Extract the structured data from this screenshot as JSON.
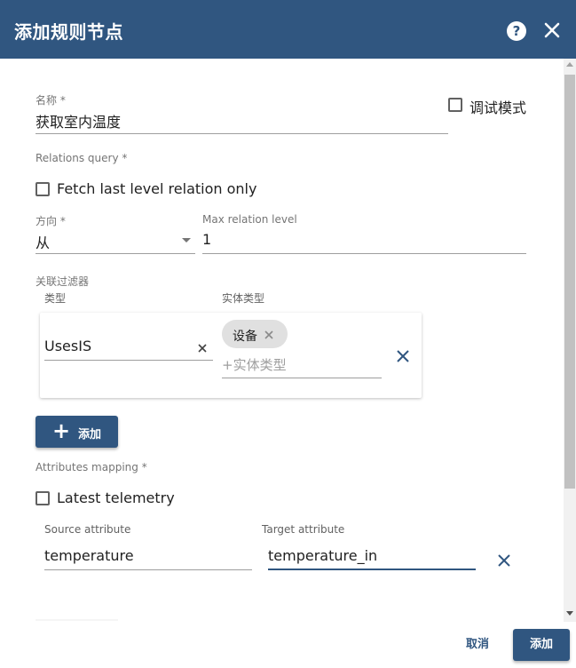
{
  "header": {
    "title": "添加规则节点",
    "help_icon": "question-circle-icon",
    "help_glyph": "?",
    "close_icon": "close-icon"
  },
  "name_field": {
    "label": "名称 *",
    "value": "获取室内温度"
  },
  "debug_mode": {
    "label": "调试模式",
    "checked": false
  },
  "relations_query": {
    "label": "Relations query *",
    "fetch_last_level": {
      "label": "Fetch last level relation only",
      "checked": false
    },
    "direction": {
      "label": "方向 *",
      "value": "从"
    },
    "max_relation_level": {
      "label": "Max relation level",
      "value": "1"
    }
  },
  "relation_filters": {
    "label": "关联过滤器",
    "column_type": "类型",
    "column_entity_types": "实体类型",
    "rows": [
      {
        "type_value": "UsesIS",
        "entity_type_chips": [
          "设备"
        ],
        "entity_type_placeholder": "+实体类型"
      }
    ],
    "add_button": {
      "icon": "plus-icon",
      "glyph": "+",
      "label": "添加"
    }
  },
  "attributes_mapping": {
    "label": "Attributes mapping *",
    "latest_telemetry": {
      "label": "Latest telemetry",
      "checked": false
    },
    "column_source": "Source attribute",
    "column_target": "Target attribute",
    "rows": [
      {
        "source": "temperature",
        "target": "temperature_in"
      }
    ]
  },
  "footer": {
    "cancel_label": "取消",
    "add_label": "添加"
  },
  "colors": {
    "primary": "#305680",
    "chip_bg": "#e0e0e0",
    "label_gray": "#757575"
  }
}
